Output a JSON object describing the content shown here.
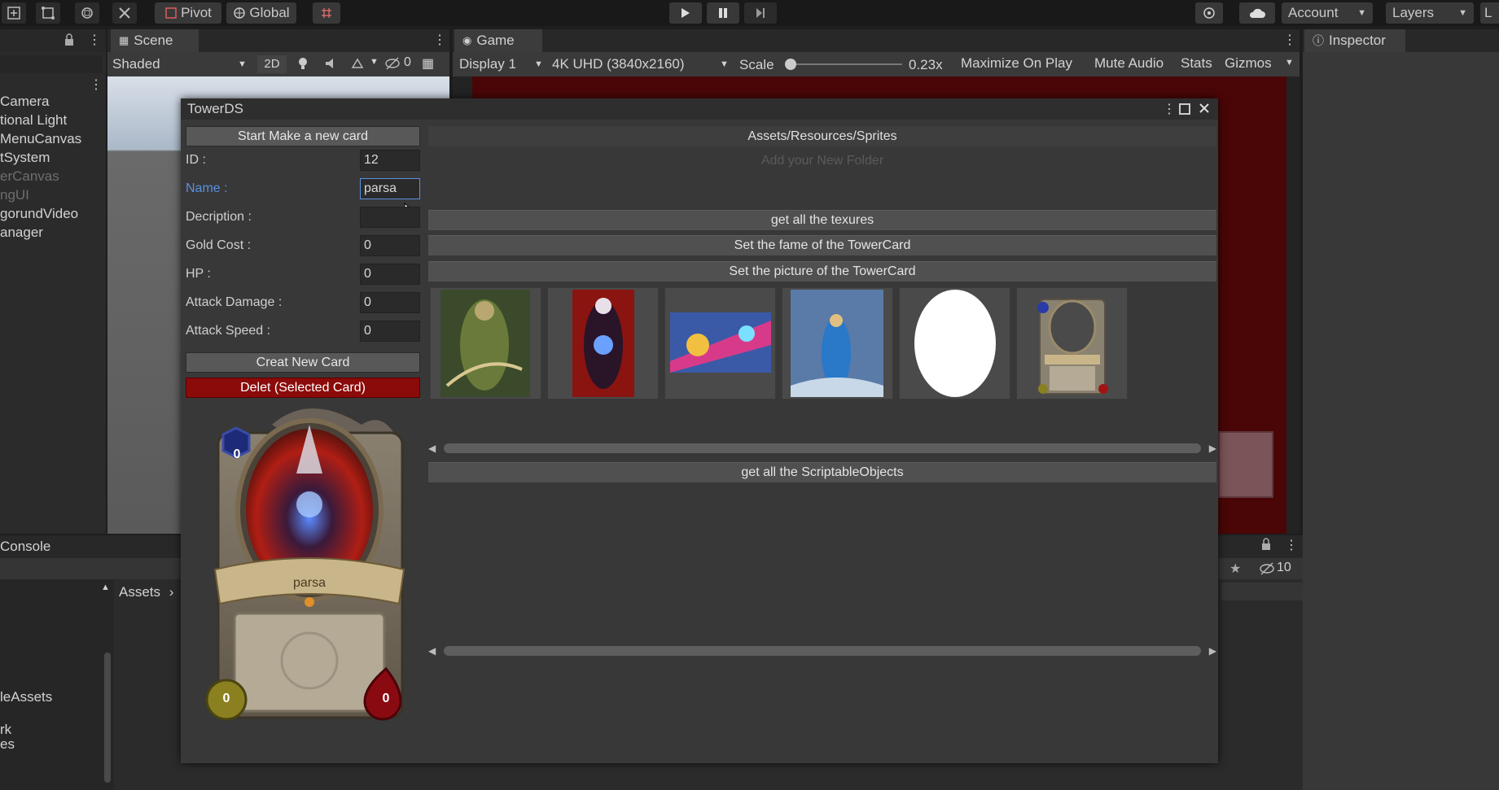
{
  "toolbar": {
    "pivot_label": "Pivot",
    "global_label": "Global",
    "account_label": "Account",
    "layers_label": "Layers",
    "layout_label": "L"
  },
  "scene": {
    "tab_label": "Scene",
    "shading_mode": "Shaded",
    "toggle_2d": "2D",
    "hidden_count": "0"
  },
  "game": {
    "tab_label": "Game",
    "display": "Display 1",
    "resolution": "4K UHD (3840x2160)",
    "scale_label": "Scale",
    "scale_value": "0.23x",
    "maximize_label": "Maximize On Play",
    "mute_label": "Mute Audio",
    "stats_label": "Stats",
    "gizmos_label": "Gizmos"
  },
  "inspector": {
    "tab_label": "Inspector"
  },
  "hierarchy": {
    "items": [
      {
        "label": "Camera",
        "dim": false
      },
      {
        "label": "tional Light",
        "dim": false
      },
      {
        "label": "MenuCanvas",
        "dim": false
      },
      {
        "label": "tSystem",
        "dim": false
      },
      {
        "label": "erCanvas",
        "dim": true
      },
      {
        "label": "ngUI",
        "dim": true
      },
      {
        "label": "gorundVideo",
        "dim": false
      },
      {
        "label": "anager",
        "dim": false
      }
    ]
  },
  "console": {
    "tab_label": "Console"
  },
  "project": {
    "breadcrumb": "Assets",
    "hidden_count": "10",
    "items": [
      "leAssets",
      "rk",
      "es"
    ]
  },
  "tower_window": {
    "title": "TowerDS",
    "start_button": "Start Make a new card",
    "fields": {
      "id": {
        "label": "ID :",
        "value": "12"
      },
      "name": {
        "label": "Name :",
        "value": "parsa"
      },
      "description": {
        "label": "Decription :",
        "value": ""
      },
      "gold_cost": {
        "label": "Gold Cost :",
        "value": "0"
      },
      "hp": {
        "label": "HP :",
        "value": "0"
      },
      "attack_damage": {
        "label": "Attack Damage :",
        "value": "0"
      },
      "attack_speed": {
        "label": "Attack Speed :",
        "value": "0"
      }
    },
    "create_button": "Creat New Card",
    "delete_button": "Delet (Selected Card)",
    "path_label": "Assets/Resources/Sprites",
    "folder_placeholder": "Add your New Folder",
    "get_textures_button": "get all the texures",
    "set_frame_button": "Set the fame of the TowerCard",
    "set_picture_button": "Set the picture of the TowerCard",
    "get_scriptable_button": "get all the ScriptableObjects",
    "texture_thumbnails": [
      "green-warrior",
      "dark-sorceress",
      "pink-cannon-hero",
      "blue-mage",
      "white-oval",
      "card-frame"
    ],
    "preview": {
      "mana": "0",
      "name": "parsa",
      "gold": "0",
      "hp": "0"
    }
  },
  "colors": {
    "delete_button": "#8b0a0a",
    "game_view_bg": "#4a0606",
    "name_label_active": "#5a8fe0"
  }
}
